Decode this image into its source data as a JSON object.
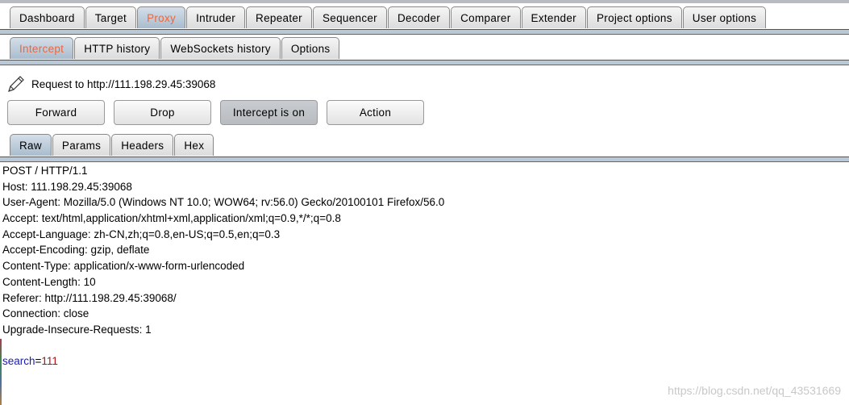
{
  "main_tabs": [
    "Dashboard",
    "Target",
    "Proxy",
    "Intruder",
    "Repeater",
    "Sequencer",
    "Decoder",
    "Comparer",
    "Extender",
    "Project options",
    "User options"
  ],
  "main_tabs_active": "Proxy",
  "proxy_tabs": [
    "Intercept",
    "HTTP history",
    "WebSockets history",
    "Options"
  ],
  "proxy_tabs_active": "Intercept",
  "request_label": "Request to http://111.198.29.45:39068",
  "buttons": {
    "forward": "Forward",
    "drop": "Drop",
    "intercept": "Intercept is on",
    "action": "Action"
  },
  "view_tabs": [
    "Raw",
    "Params",
    "Headers",
    "Hex"
  ],
  "view_tabs_active": "Raw",
  "request_lines": [
    "POST / HTTP/1.1",
    "Host: 111.198.29.45:39068",
    "User-Agent: Mozilla/5.0 (Windows NT 10.0; WOW64; rv:56.0) Gecko/20100101 Firefox/56.0",
    "Accept: text/html,application/xhtml+xml,application/xml;q=0.9,*/*;q=0.8",
    "Accept-Language: zh-CN,zh;q=0.8,en-US;q=0.5,en;q=0.3",
    "Accept-Encoding: gzip, deflate",
    "Content-Type: application/x-www-form-urlencoded",
    "Content-Length: 10",
    "Referer: http://111.198.29.45:39068/",
    "Connection: close",
    "Upgrade-Insecure-Requests: 1",
    ""
  ],
  "body_param": {
    "name": "search",
    "eq": "=",
    "value": "111"
  },
  "watermark": "https://blog.csdn.net/qq_43531669",
  "colors": {
    "active_tab_text": "#f0653c",
    "param_name": "#1a1ab8",
    "param_value": "#b01010"
  }
}
